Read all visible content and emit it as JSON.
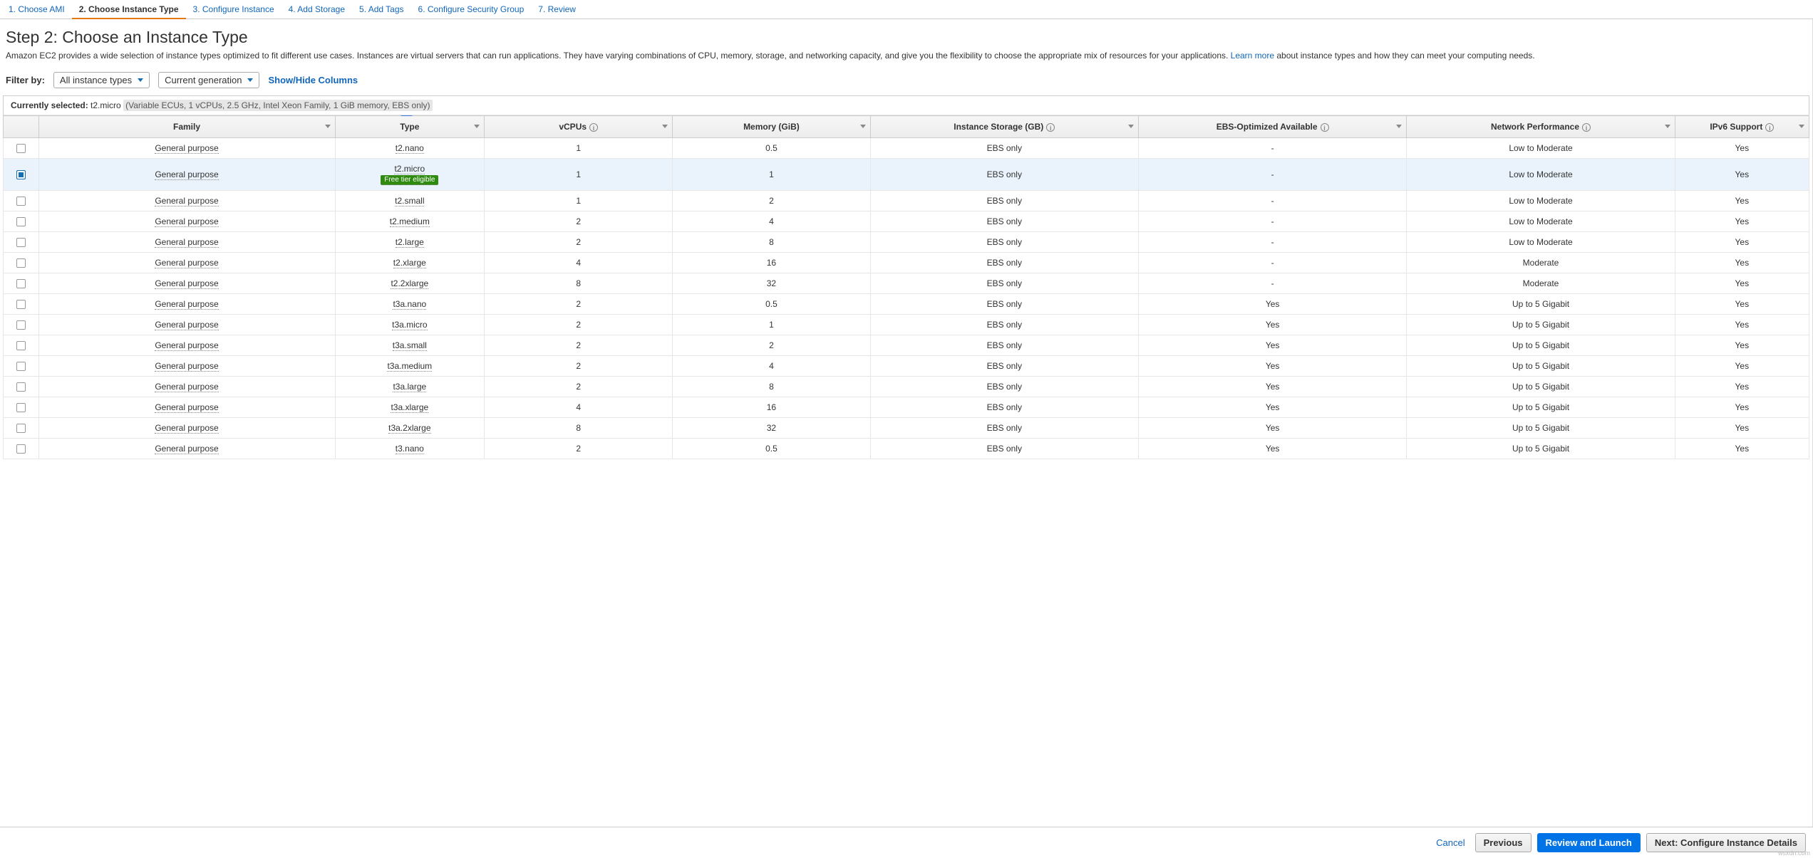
{
  "tabs": [
    {
      "label": "1. Choose AMI"
    },
    {
      "label": "2. Choose Instance Type",
      "active": true
    },
    {
      "label": "3. Configure Instance"
    },
    {
      "label": "4. Add Storage"
    },
    {
      "label": "5. Add Tags"
    },
    {
      "label": "6. Configure Security Group"
    },
    {
      "label": "7. Review"
    }
  ],
  "heading": "Step 2: Choose an Instance Type",
  "intro": {
    "text_a": "Amazon EC2 provides a wide selection of instance types optimized to fit different use cases. Instances are virtual servers that can run applications. They have varying combinations of CPU, memory, storage, and networking capacity, and give you the flexibility to choose the appropriate mix of resources for your applications. ",
    "learn": "Learn more",
    "text_b": " about instance types and how they can meet your computing needs."
  },
  "filter": {
    "label": "Filter by:",
    "dd1": "All instance types",
    "dd2": "Current generation",
    "toggle": "Show/Hide Columns"
  },
  "currently": {
    "label": "Currently selected:",
    "type": "t2.micro",
    "details": "(Variable ECUs, 1 vCPUs, 2.5 GHz, Intel Xeon Family, 1 GiB memory, EBS only)"
  },
  "cols": [
    "",
    "Family",
    "Type",
    "vCPUs",
    "Memory (GiB)",
    "Instance Storage (GB)",
    "EBS-Optimized Available",
    "Network Performance",
    "IPv6 Support"
  ],
  "info_cols": [
    3,
    5,
    6,
    7,
    8
  ],
  "tri_cols": [
    1,
    2,
    3,
    4,
    5,
    6,
    7,
    8
  ],
  "rows": [
    {
      "sel": false,
      "family": "General purpose",
      "type": "t2.nano",
      "free": false,
      "vcpu": "1",
      "mem": "0.5",
      "stor": "EBS only",
      "ebs": "-",
      "net": "Low to Moderate",
      "ipv6": "Yes"
    },
    {
      "sel": true,
      "family": "General purpose",
      "type": "t2.micro",
      "free": true,
      "vcpu": "1",
      "mem": "1",
      "stor": "EBS only",
      "ebs": "-",
      "net": "Low to Moderate",
      "ipv6": "Yes"
    },
    {
      "sel": false,
      "family": "General purpose",
      "type": "t2.small",
      "free": false,
      "vcpu": "1",
      "mem": "2",
      "stor": "EBS only",
      "ebs": "-",
      "net": "Low to Moderate",
      "ipv6": "Yes"
    },
    {
      "sel": false,
      "family": "General purpose",
      "type": "t2.medium",
      "free": false,
      "vcpu": "2",
      "mem": "4",
      "stor": "EBS only",
      "ebs": "-",
      "net": "Low to Moderate",
      "ipv6": "Yes"
    },
    {
      "sel": false,
      "family": "General purpose",
      "type": "t2.large",
      "free": false,
      "vcpu": "2",
      "mem": "8",
      "stor": "EBS only",
      "ebs": "-",
      "net": "Low to Moderate",
      "ipv6": "Yes"
    },
    {
      "sel": false,
      "family": "General purpose",
      "type": "t2.xlarge",
      "free": false,
      "vcpu": "4",
      "mem": "16",
      "stor": "EBS only",
      "ebs": "-",
      "net": "Moderate",
      "ipv6": "Yes"
    },
    {
      "sel": false,
      "family": "General purpose",
      "type": "t2.2xlarge",
      "free": false,
      "vcpu": "8",
      "mem": "32",
      "stor": "EBS only",
      "ebs": "-",
      "net": "Moderate",
      "ipv6": "Yes"
    },
    {
      "sel": false,
      "family": "General purpose",
      "type": "t3a.nano",
      "free": false,
      "vcpu": "2",
      "mem": "0.5",
      "stor": "EBS only",
      "ebs": "Yes",
      "net": "Up to 5 Gigabit",
      "ipv6": "Yes"
    },
    {
      "sel": false,
      "family": "General purpose",
      "type": "t3a.micro",
      "free": false,
      "vcpu": "2",
      "mem": "1",
      "stor": "EBS only",
      "ebs": "Yes",
      "net": "Up to 5 Gigabit",
      "ipv6": "Yes"
    },
    {
      "sel": false,
      "family": "General purpose",
      "type": "t3a.small",
      "free": false,
      "vcpu": "2",
      "mem": "2",
      "stor": "EBS only",
      "ebs": "Yes",
      "net": "Up to 5 Gigabit",
      "ipv6": "Yes"
    },
    {
      "sel": false,
      "family": "General purpose",
      "type": "t3a.medium",
      "free": false,
      "vcpu": "2",
      "mem": "4",
      "stor": "EBS only",
      "ebs": "Yes",
      "net": "Up to 5 Gigabit",
      "ipv6": "Yes"
    },
    {
      "sel": false,
      "family": "General purpose",
      "type": "t3a.large",
      "free": false,
      "vcpu": "2",
      "mem": "8",
      "stor": "EBS only",
      "ebs": "Yes",
      "net": "Up to 5 Gigabit",
      "ipv6": "Yes"
    },
    {
      "sel": false,
      "family": "General purpose",
      "type": "t3a.xlarge",
      "free": false,
      "vcpu": "4",
      "mem": "16",
      "stor": "EBS only",
      "ebs": "Yes",
      "net": "Up to 5 Gigabit",
      "ipv6": "Yes"
    },
    {
      "sel": false,
      "family": "General purpose",
      "type": "t3a.2xlarge",
      "free": false,
      "vcpu": "8",
      "mem": "32",
      "stor": "EBS only",
      "ebs": "Yes",
      "net": "Up to 5 Gigabit",
      "ipv6": "Yes"
    },
    {
      "sel": false,
      "family": "General purpose",
      "type": "t3.nano",
      "free": false,
      "vcpu": "2",
      "mem": "0.5",
      "stor": "EBS only",
      "ebs": "Yes",
      "net": "Up to 5 Gigabit",
      "ipv6": "Yes"
    }
  ],
  "free_tier_label": "Free tier eligible",
  "footer": {
    "cancel": "Cancel",
    "prev": "Previous",
    "review": "Review and Launch",
    "next": "Next: Configure Instance Details"
  },
  "watermark": "wsxdn.com"
}
